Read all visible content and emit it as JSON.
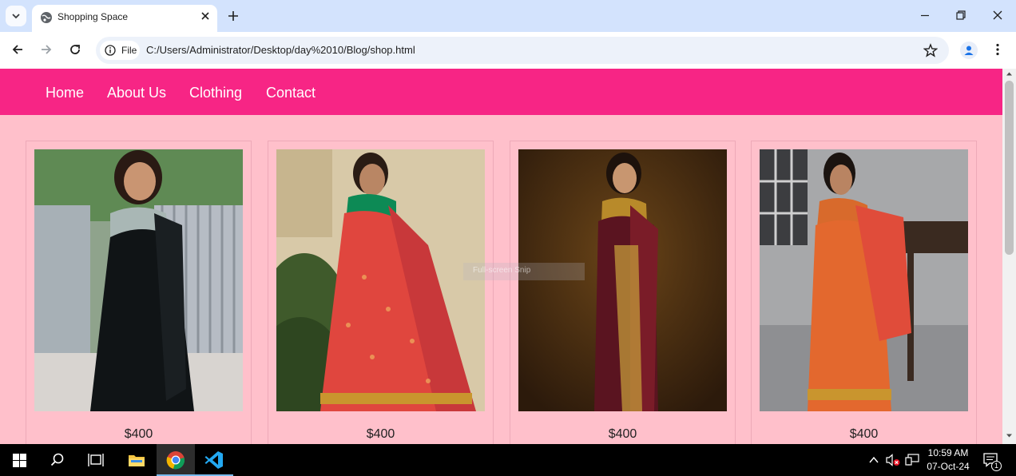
{
  "browser": {
    "tab_title": "Shopping Space",
    "site_chip_label": "File",
    "url": "C:/Users/Administrator/Desktop/day%2010/Blog/shop.html"
  },
  "page": {
    "nav": [
      "Home",
      "About Us",
      "Clothing",
      "Contact"
    ],
    "products": [
      {
        "price": "$400",
        "saree_color": "black"
      },
      {
        "price": "$400",
        "saree_color": "red"
      },
      {
        "price": "$400",
        "saree_color": "maroon"
      },
      {
        "price": "$400",
        "saree_color": "orange"
      }
    ],
    "overlay_text": "Full-screen Snip",
    "colors": {
      "nav_bg": "#f72585",
      "page_bg": "#ffc0cb"
    }
  },
  "taskbar": {
    "time": "10:59 AM",
    "date": "07-Oct-24",
    "notification_count": "1"
  }
}
